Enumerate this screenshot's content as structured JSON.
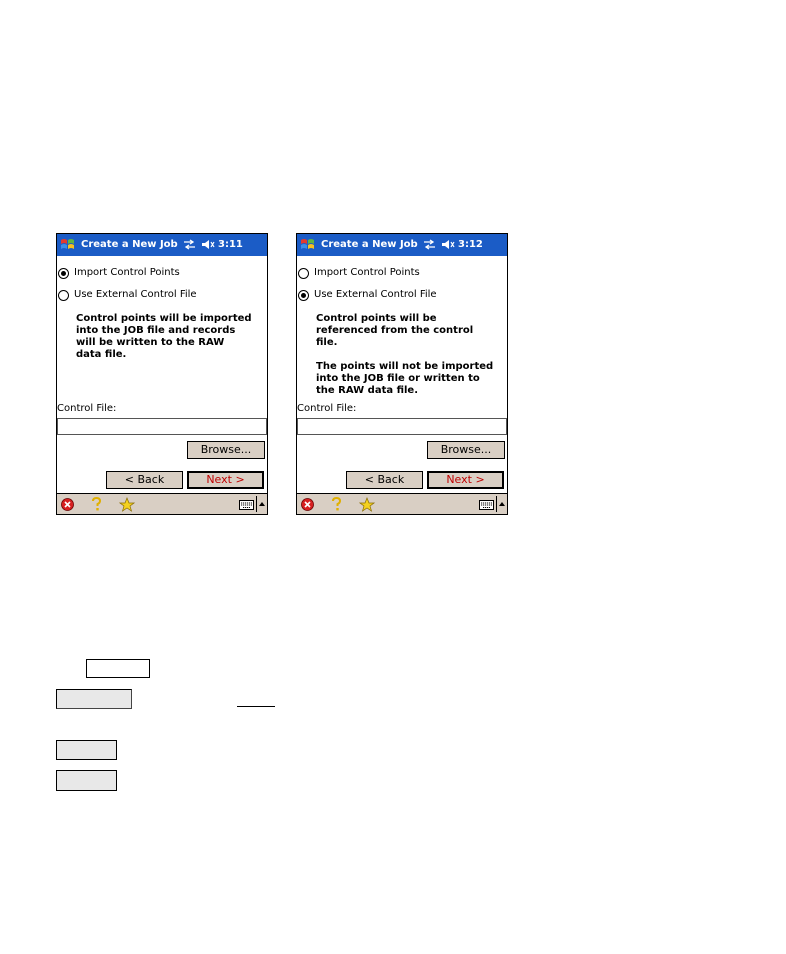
{
  "screens": [
    {
      "title": "Create a New Job",
      "time": "3:11",
      "radio_import": {
        "label": "Import Control Points",
        "checked": true
      },
      "radio_external": {
        "label": "Use External Control File",
        "checked": false
      },
      "description": "Control points will be imported\ninto the JOB file and records\nwill be written to the RAW\ndata file.",
      "control_file_label": "Control File:",
      "control_file_value": "",
      "browse_label": "Browse...",
      "back_label": "< Back",
      "next_label": "Next >"
    },
    {
      "title": "Create a New Job",
      "time": "3:12",
      "radio_import": {
        "label": "Import Control Points",
        "checked": false
      },
      "radio_external": {
        "label": "Use External Control File",
        "checked": true
      },
      "description": "Control points will be\nreferenced from the control\nfile.\n\nThe points will not be imported\ninto the JOB file or written to\nthe RAW data file.",
      "control_file_label": "Control File:",
      "control_file_value": "",
      "browse_label": "Browse...",
      "back_label": "< Back",
      "next_label": "Next >"
    }
  ],
  "icons": {
    "start": "windows-flag-icon",
    "connectivity": "connectivity-icon",
    "volume": "speaker-icon",
    "close": "close-circle-icon",
    "help": "help-question-icon",
    "favorites": "star-favorites-icon",
    "keyboard": "keyboard-icon",
    "sip_arrow": "up-arrow-icon"
  },
  "colors": {
    "titlebar": "#1b5cc6",
    "button_face": "#d9cfc4",
    "next_text": "#c00000"
  }
}
